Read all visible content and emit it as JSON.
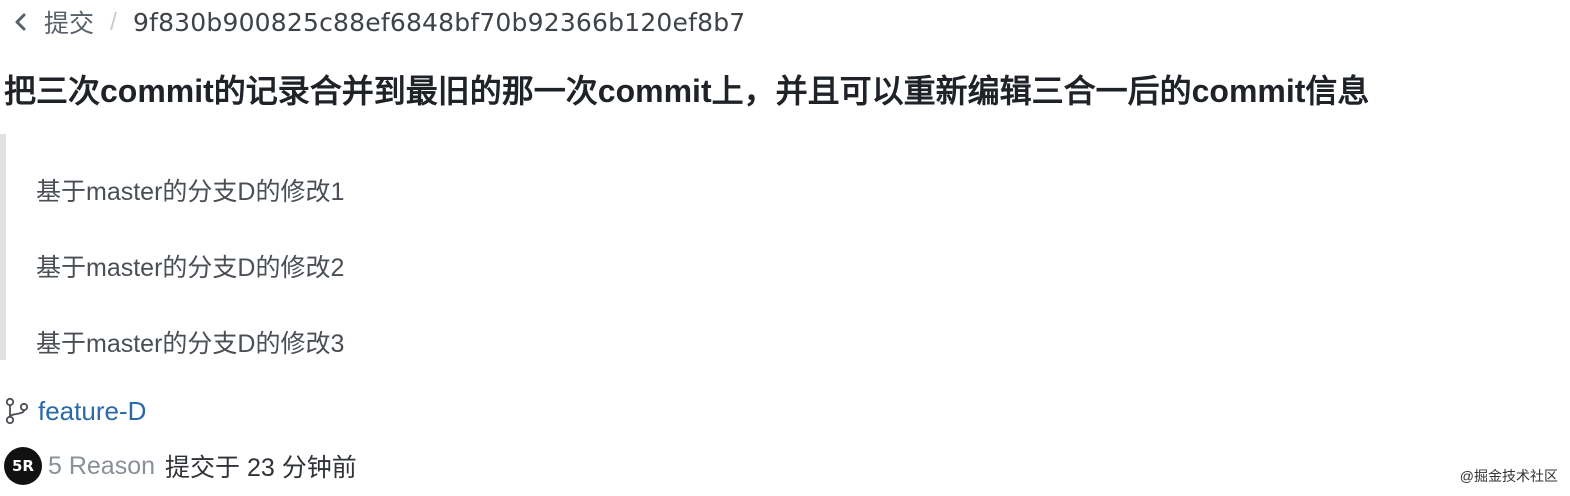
{
  "breadcrumb": {
    "back_label": "提交",
    "separator": "/",
    "sha": "9f830b900825c88ef6848bf70b92366b120ef8b7"
  },
  "commit": {
    "title": "把三次commit的记录合并到最旧的那一次commit上，并且可以重新编辑三合一后的commit信息",
    "body_lines": [
      "基于master的分支D的修改1",
      "基于master的分支D的修改2",
      "基于master的分支D的修改3"
    ],
    "branch": "feature-D",
    "author": {
      "avatar_text": "5R",
      "name": "5 Reason",
      "committed_text": "提交于 23 分钟前"
    }
  },
  "watermark": "@掘金技术社区",
  "colors": {
    "link": "#2a6aa8",
    "muted": "#586069",
    "quote_border": "#dfe2e5"
  },
  "icons": {
    "back": "chevron-left-icon",
    "branch": "git-branch-icon"
  }
}
